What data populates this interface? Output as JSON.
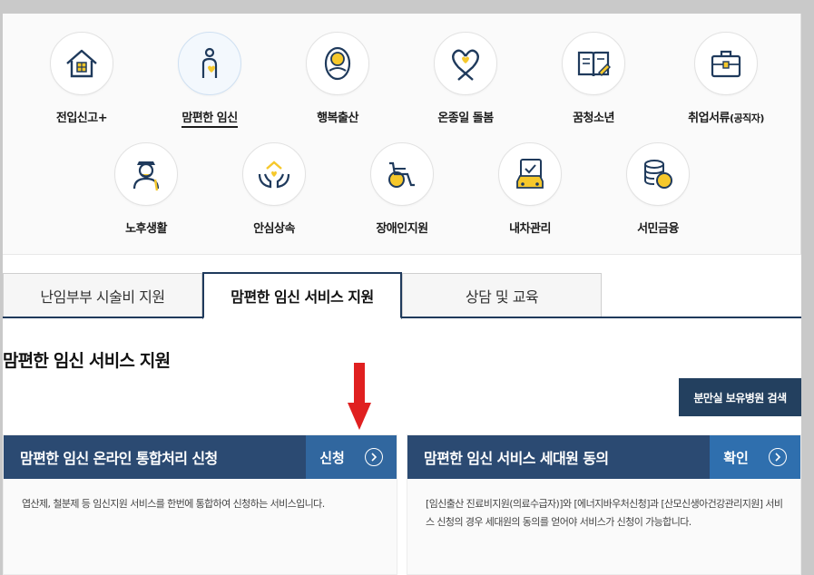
{
  "services": {
    "row1": [
      {
        "label": "전입신고+",
        "icon": "house-icon"
      },
      {
        "label": "맘편한 임신",
        "icon": "pregnant-woman-icon",
        "active": true
      },
      {
        "label": "행복출산",
        "icon": "baby-icon"
      },
      {
        "label": "온종일 돌봄",
        "icon": "heart-ribbon-icon"
      },
      {
        "label": "꿈청소년",
        "icon": "open-book-icon"
      },
      {
        "label": "취업서류",
        "label_small": "(공직자)",
        "icon": "briefcase-icon"
      }
    ],
    "row2": [
      {
        "label": "노후생활",
        "icon": "elderly-man-icon"
      },
      {
        "label": "안심상속",
        "icon": "hands-house-icon"
      },
      {
        "label": "장애인지원",
        "icon": "wheelchair-icon"
      },
      {
        "label": "내차관리",
        "icon": "car-document-icon"
      },
      {
        "label": "서민금융",
        "icon": "coins-icon"
      }
    ]
  },
  "tabs": [
    {
      "label": "난임부부 시술비 지원"
    },
    {
      "label": "맘편한 임신 서비스 지원",
      "active": true
    },
    {
      "label": "상담 및 교육"
    }
  ],
  "section_title": "맘편한 임신 서비스 지원",
  "search_button": "분만실 보유병원 검색",
  "cards": [
    {
      "title": "맘편한 임신 온라인 통합처리 신청",
      "action": "신청",
      "description": "엽산제, 철분제 등 임신지원 서비스를 한번에 통합하여 신청하는 서비스입니다."
    },
    {
      "title": "맘편한 임신 서비스 세대원 동의",
      "action": "확인",
      "description": "[임신출산 진료비지원(의료수급자)]와 [에너지바우처신청]과 [산모신생아건강관리지원] 서비스 신청의 경우 세대원의 동의를 얻어야 서비스가 신청이 가능합니다."
    }
  ],
  "colors": {
    "navy": "#2b4a72",
    "action_blue": "#31679f",
    "icon_stroke": "#1f3a5c",
    "icon_accent": "#f6c82b",
    "annotation_red": "#e02020"
  }
}
